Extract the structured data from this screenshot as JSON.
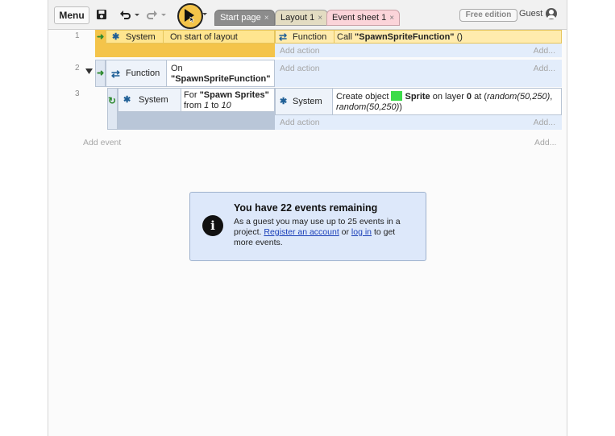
{
  "toolbar": {
    "menu_label": "Menu",
    "tabs": [
      {
        "label": "Start page",
        "close": "×"
      },
      {
        "label": "Layout 1",
        "close": "×"
      },
      {
        "label": "Event sheet 1",
        "close": "×"
      }
    ],
    "free_edition": "Free edition",
    "user": "Guest"
  },
  "events": [
    {
      "number": "1",
      "condition": {
        "object": "System",
        "text": "On start of layout"
      },
      "actions": [
        {
          "object": "Function",
          "prefix": "Call ",
          "target": "\"SpawnSpriteFunction\"",
          "suffix": " ()"
        }
      ],
      "add_action": "Add action",
      "add_short": "Add..."
    },
    {
      "number": "2",
      "condition": {
        "object": "Function",
        "text_line1": "On",
        "text_line2": "\"SpawnSpriteFunction\""
      },
      "add_action": "Add action",
      "add_short": "Add..."
    },
    {
      "number": "3",
      "condition": {
        "object": "System",
        "prefix": "For ",
        "name": "\"Spawn Sprites\"",
        "from": "from ",
        "start": "1",
        "to": " to ",
        "end": "10"
      },
      "actions": [
        {
          "object": "System",
          "text_a": "Create object ",
          "sprite": "Sprite",
          "text_b": " on layer ",
          "layer": "0",
          "text_c": " at (",
          "x": "random(50,250)",
          "comma": ",",
          "y": "random(50,250)",
          "close": ")"
        }
      ],
      "add_action": "Add action",
      "add_short": "Add..."
    }
  ],
  "add_event": "Add event",
  "add_event_short": "Add...",
  "notice": {
    "title": "You have 22 events remaining",
    "line1": "As a guest you may use up to 25 events in a project. ",
    "register_link": "Register an account",
    "or": " or ",
    "login_link": "log in",
    "line2": " to get more events."
  },
  "colors": {
    "event1_bar": "#f4c44a",
    "event_highlight": "#ffebad",
    "condition_bg": "#e7f0fd",
    "add_bg": "#e3edfb",
    "sprite_green": "#3cdc4a",
    "toast_bg": "#dde8fa"
  }
}
